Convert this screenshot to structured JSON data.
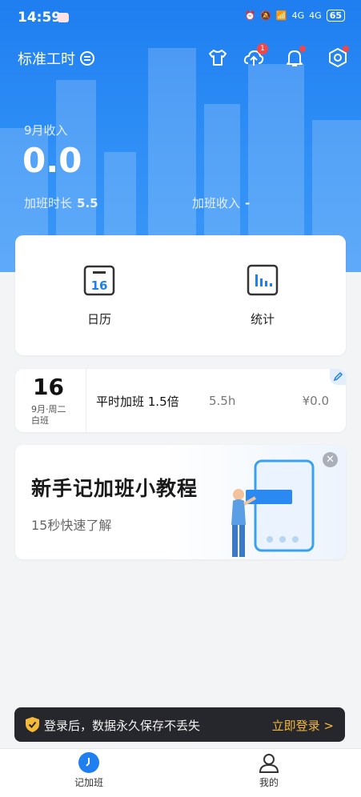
{
  "status_bar": {
    "time": "14:59",
    "signal1": "4G",
    "signal2": "4G",
    "battery": "65"
  },
  "header": {
    "title": "标准工时",
    "icons": [
      "shirt-icon",
      "cloud-upload-icon",
      "bell-icon",
      "settings-icon"
    ],
    "upload_badge": "1"
  },
  "summary": {
    "month_label": "9月收入",
    "income": "0.0",
    "overtime_hours_label": "加班时长",
    "overtime_hours_value": "5.5",
    "overtime_income_label": "加班收入",
    "overtime_income_value": "-"
  },
  "quick_actions": [
    {
      "label": "日历",
      "icon": "calendar-icon",
      "icon_text": "16"
    },
    {
      "label": "统计",
      "icon": "bar-chart-icon"
    }
  ],
  "record": {
    "day": "16",
    "date_line": "9月·周二",
    "shift": "白班",
    "type": "平时加班 1.5倍",
    "hours": "5.5h",
    "amount": "¥0.0"
  },
  "tutorial": {
    "title": "新手记加班小教程",
    "subtitle": "15秒快速了解"
  },
  "login_bar": {
    "text": "登录后，数据永久保存不丢失",
    "button": "立即登录 >"
  },
  "tabs": [
    {
      "label": "记加班",
      "icon": "clock-icon",
      "active": true
    },
    {
      "label": "我的",
      "icon": "user-icon",
      "active": false
    }
  ],
  "colors": {
    "primary": "#1f7ef0",
    "accent": "#f5b93a",
    "badge": "#f04848"
  }
}
